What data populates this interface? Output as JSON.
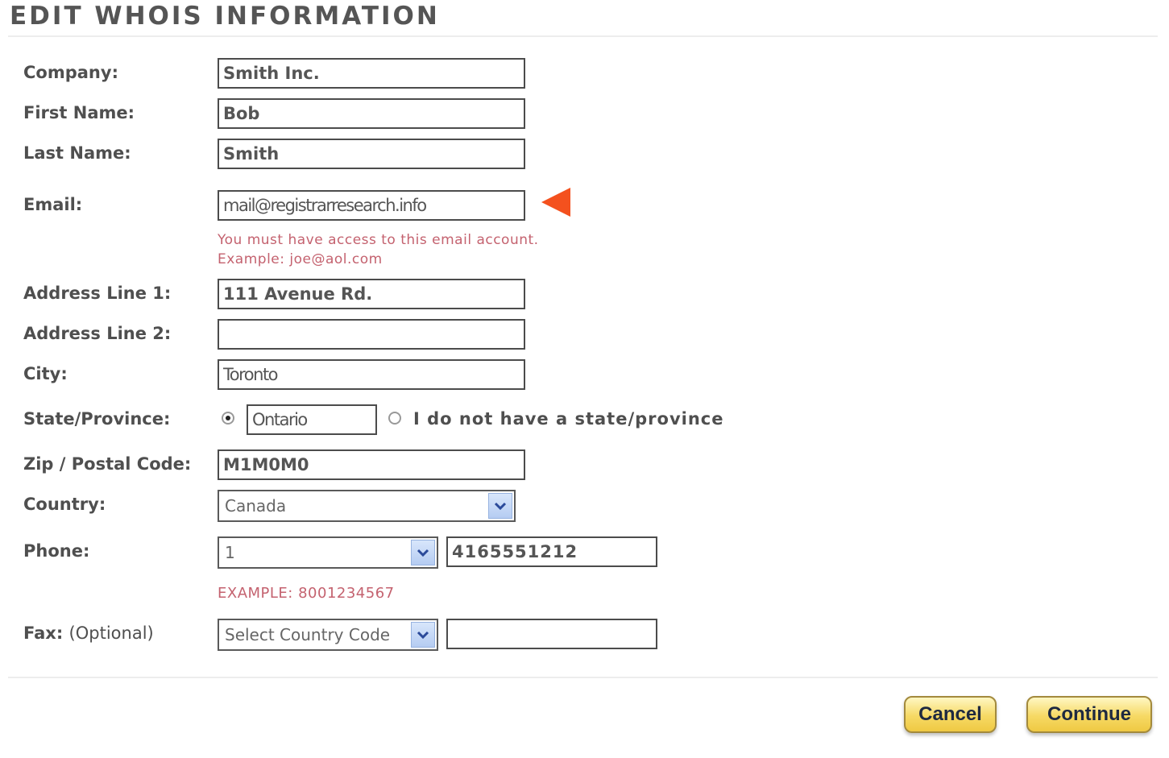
{
  "page_title": "EDIT WHOIS INFORMATION",
  "form": {
    "company": {
      "label": "Company:",
      "value": "Smith Inc."
    },
    "first_name": {
      "label": "First Name:",
      "value": "Bob"
    },
    "last_name": {
      "label": "Last Name:",
      "value": "Smith"
    },
    "email": {
      "label": "Email:",
      "value": "mail@registrarresearch.info",
      "hint_1": "You must have access to this email account.",
      "hint_2": "Example: joe@aol.com"
    },
    "address_1": {
      "label": "Address Line 1:",
      "value": "111 Avenue Rd."
    },
    "address_2": {
      "label": "Address Line 2:",
      "value": ""
    },
    "city": {
      "label": "City:",
      "value": "Toronto"
    },
    "state": {
      "label": "State/Province:",
      "value": "Ontario",
      "selected": true,
      "no_state_label": "I do not have a state/province"
    },
    "zip": {
      "label": "Zip / Postal Code:",
      "value": "M1M0M0"
    },
    "country": {
      "label": "Country:",
      "selected": "Canada"
    },
    "phone": {
      "label": "Phone:",
      "country_code": "1",
      "number": "4165551212",
      "example": "EXAMPLE: 8001234567"
    },
    "fax": {
      "label": "Fax:",
      "optional": "(Optional)",
      "country_code": "Select Country Code",
      "number": ""
    }
  },
  "buttons": {
    "cancel": "Cancel",
    "continue": "Continue"
  },
  "colors": {
    "accent_arrow": "#f4511e",
    "hint_text": "#c4626f",
    "button_gold": "#f6d964"
  },
  "icons": {
    "pointer": "left-triangle-arrow",
    "dropdown": "chevron-down-icon"
  }
}
